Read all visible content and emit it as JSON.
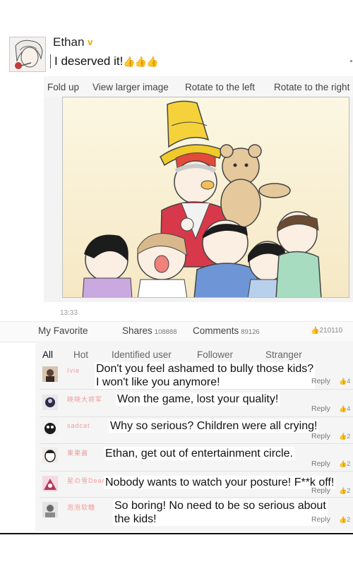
{
  "author": {
    "name": "Ethan",
    "badge": "v"
  },
  "post": {
    "text": "I deserved it!",
    "emoji": "👍👍👍"
  },
  "image_toolbar": [
    "Fold up",
    "View larger image",
    "Rotate to the left",
    "Rotate to the right"
  ],
  "timestamp": "13:33",
  "actions": {
    "favorite": "My Favorite",
    "shares_label": "Shares",
    "shares_count": "108888",
    "comments_label": "Comments",
    "comments_count": "89126",
    "likes_count": "210110"
  },
  "filters": [
    "All",
    "Hot",
    "Identified user",
    "Follower",
    "Stranger"
  ],
  "comments": [
    {
      "user": "Ivie",
      "text_line1": "Don't you feel ashamed to bully those kids?",
      "text_line2": "I won't like you anymore!",
      "reply": "Reply",
      "likes": "4"
    },
    {
      "user": "晓晓大将军",
      "text_line1": "Won the game, lost your quality!",
      "text_line2": "",
      "reply": "Reply",
      "likes": "4"
    },
    {
      "user": "sadcat",
      "text_line1": "Why so serious? Children were all crying!",
      "text_line2": "",
      "reply": "Reply",
      "likes": "2"
    },
    {
      "user": "果果酱",
      "text_line1": "Ethan, get out of entertainment circle.",
      "text_line2": "",
      "reply": "Reply",
      "likes": "2"
    },
    {
      "user": "星の雪Dear",
      "text_line1": "Nobody wants to watch your posture! F**k off!",
      "text_line2": "",
      "reply": "Reply",
      "likes": "2"
    },
    {
      "user": "泡泡软糖",
      "text_line1": "So boring! No need to be so serious about",
      "text_line2": "the kids!",
      "reply": "Reply",
      "likes": "2"
    }
  ]
}
